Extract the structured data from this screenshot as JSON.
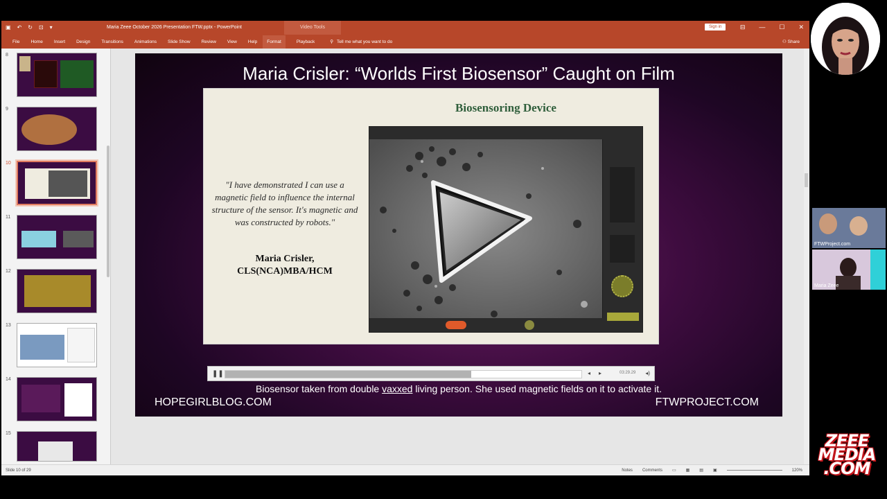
{
  "window": {
    "title": "Maria Zeee October 2026 Presentation FTW.pptx  -  PowerPoint",
    "context_tools": "Video Tools",
    "sign_in": "Sign in",
    "win_buttons": [
      "⊟",
      "—",
      "☐",
      "✕"
    ]
  },
  "quick_access": [
    "▣",
    "↶",
    "↻",
    "⊡",
    "▾"
  ],
  "ribbon": {
    "tabs": [
      "File",
      "Home",
      "Insert",
      "Design",
      "Transitions",
      "Animations",
      "Slide Show",
      "Review",
      "View",
      "Help",
      "Format",
      "Playback"
    ],
    "tell_me": "Tell me what you want to do",
    "share": "Share"
  },
  "thumbnails": [
    {
      "num": "8",
      "active": false
    },
    {
      "num": "9",
      "active": false
    },
    {
      "num": "10",
      "active": true
    },
    {
      "num": "11",
      "active": false
    },
    {
      "num": "12",
      "active": false
    },
    {
      "num": "13",
      "active": false
    },
    {
      "num": "14",
      "active": false
    },
    {
      "num": "15",
      "active": false
    }
  ],
  "slide": {
    "title": "Maria Crisler: “Worlds First Biosensor” Caught on Film",
    "quote": "\"I have demonstrated I can use a magnetic field to influence the internal structure of the sensor. It's magnetic and was constructed by robots.\"",
    "author": "Maria Crisler, CLS(NCA)MBA/HCM",
    "panel_heading": "Biosensoring Device",
    "caption_before": "Biosensor taken from double ",
    "caption_underlined": "vaxxed",
    "caption_after": " living person. She used magnetic fields on it to activate it.",
    "footer_left": "HOPEGIRLBLOG.COM",
    "footer_right": "FTWPROJECT.COM"
  },
  "video_controls": {
    "progress": 0.69,
    "time": "03:29.29",
    "pause_glyph": "❚❚",
    "back_glyph": "◂",
    "fwd_glyph": "▸",
    "vol_glyph": "◂)"
  },
  "status": {
    "slide_info": "Slide 10 of 29",
    "notes": "Notes",
    "comments": "Comments",
    "zoom": "120%"
  },
  "participants": [
    {
      "label": "FTWProject.com"
    },
    {
      "label": "Maria Zeee"
    }
  ],
  "brand": {
    "line1": "ZEEE",
    "line2": "MEDIA",
    "line3": ".COM"
  },
  "colors": {
    "accent": "#b7472a",
    "slide_bg": "#3e0c3f",
    "heading_green": "#2f5e3b",
    "brand_red": "#c4161c"
  }
}
